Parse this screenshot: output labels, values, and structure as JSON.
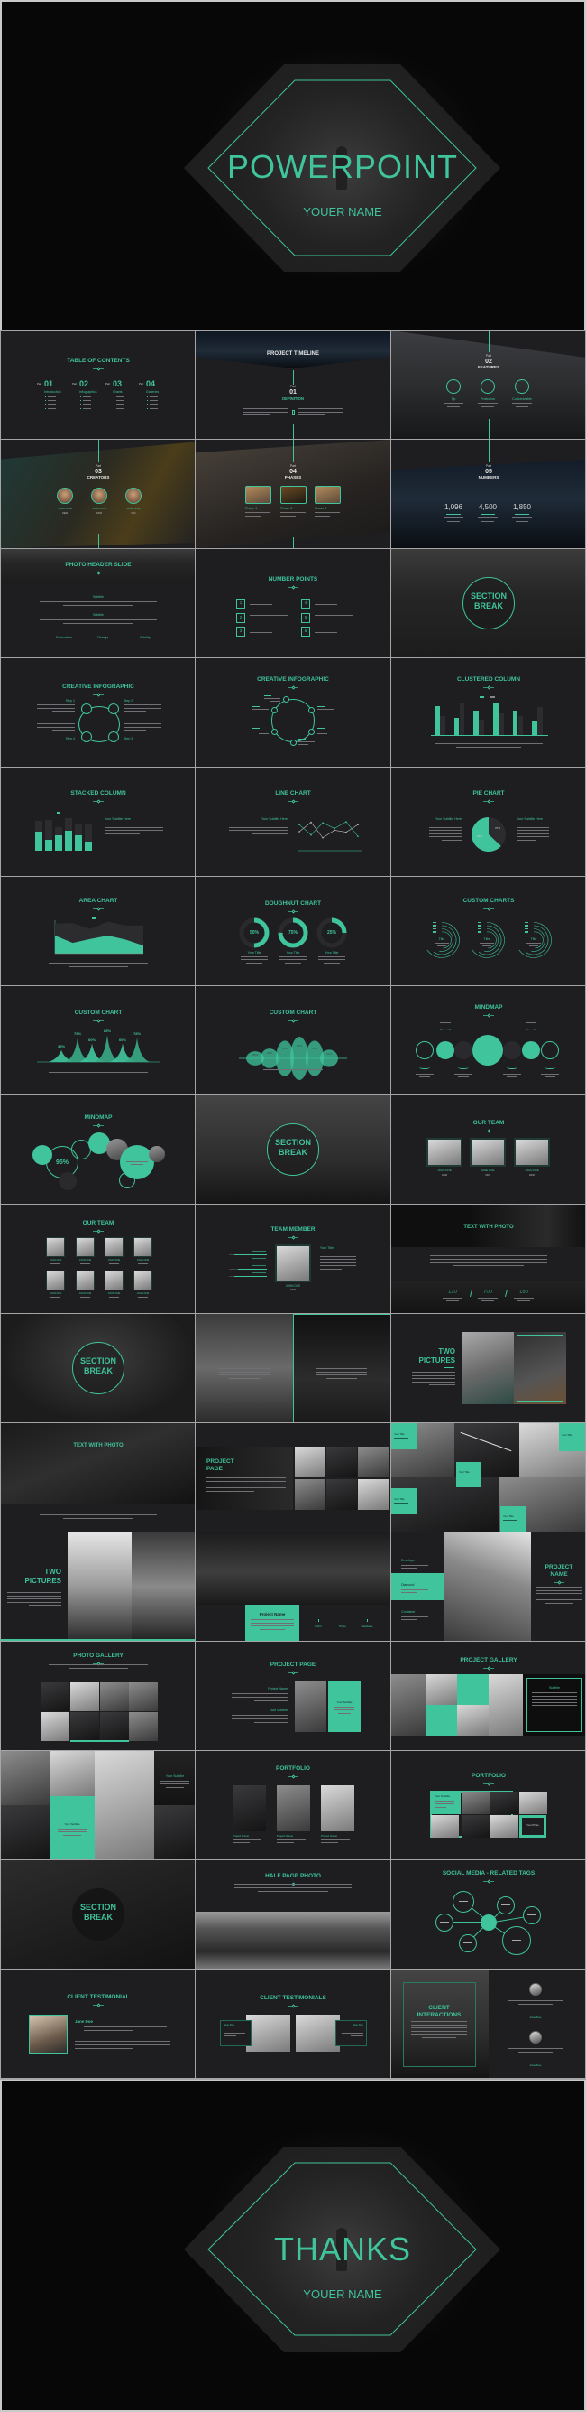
{
  "theme": {
    "accent": "#3fc49b",
    "slide_bg": "#1e1e21",
    "border": "#a5a5a5"
  },
  "cover": {
    "title": "POWERPOINT",
    "subtitle": "YOUER NAME"
  },
  "closing": {
    "title": "THANKS",
    "subtitle": "YOUER NAME"
  },
  "slides": [
    {
      "kind": "toc",
      "title": "TABLE OF CONTENTS",
      "part": "Part",
      "items": [
        {
          "num": "01",
          "label": "Introduction"
        },
        {
          "num": "02",
          "label": "Infographics"
        },
        {
          "num": "03",
          "label": "Charts"
        },
        {
          "num": "04",
          "label": "Galleries"
        }
      ]
    },
    {
      "kind": "timeline",
      "title": "PROJECT TIMELINE",
      "part": "Part",
      "num": "01",
      "heading": "DEFINITION"
    },
    {
      "kind": "features",
      "part": "Part",
      "num": "02",
      "heading": "FEATURES",
      "items": [
        "Tip",
        "Protection",
        "Customizable"
      ]
    },
    {
      "kind": "creators",
      "part": "Part",
      "num": "03",
      "heading": "CREATORS",
      "people": [
        {
          "name": "JOHN DOE",
          "role": "CEO"
        },
        {
          "name": "JOHN DOE",
          "role": "CFO"
        },
        {
          "name": "JANE DOE",
          "role": "CIO"
        }
      ]
    },
    {
      "kind": "phases",
      "part": "Part",
      "num": "04",
      "heading": "PHASES",
      "items": [
        "Phase 1",
        "Phase 2",
        "Phase 3"
      ]
    },
    {
      "kind": "numbers",
      "part": "Part",
      "num": "05",
      "heading": "NUMBERS",
      "values": [
        "1,096",
        "4,500",
        "1,850"
      ]
    },
    {
      "kind": "photoheader",
      "title": "PHOTO HEADER SLIDE",
      "subtitles": [
        "Subtitle",
        "Subtitle"
      ],
      "links": [
        "Exploration",
        "Change",
        "Fidelity"
      ]
    },
    {
      "kind": "numpoints",
      "title": "NUMBER POINTS",
      "nums": [
        "1",
        "2",
        "3",
        "4",
        "5",
        "6"
      ]
    },
    {
      "kind": "section",
      "bg": "rocks",
      "lines": [
        "SECTION",
        "BREAK"
      ]
    },
    {
      "kind": "info1",
      "title": "CREATIVE INFOGRAPHIC",
      "steps": [
        "Step 1",
        "Step 2",
        "Step 3",
        "Step 4"
      ]
    },
    {
      "kind": "info2",
      "title": "CREATIVE INFOGRAPHIC"
    },
    {
      "kind": "clustered",
      "title": "CLUSTERED COLUMN",
      "chart": {
        "type": "bar",
        "ylim": [
          0,
          11
        ],
        "series": [
          {
            "color": "#3fc49b",
            "values": [
              9.4,
              5.4,
              7.9,
              10,
              7.9,
              4.6
            ]
          },
          {
            "color": "#2c2c2f",
            "values": [
              6,
              10.5,
              5,
              7,
              6,
              9
            ]
          }
        ]
      }
    },
    {
      "kind": "stacked",
      "title": "STACKED COLUMN",
      "subtitle": "Your Subtitle Here",
      "chart": {
        "type": "stacked-bar",
        "ylim": [
          0,
          40
        ],
        "series": [
          {
            "color": "#3fc49b",
            "values": [
              21,
              12,
              17,
              22,
              17,
              10
            ]
          },
          {
            "color": "#2c2c2f",
            "values": [
              12,
              22,
              9,
              14,
              12,
              19
            ]
          }
        ]
      }
    },
    {
      "kind": "line",
      "title": "LINE CHART",
      "subtitle": "Your Subtitle Here",
      "chart": {
        "type": "line",
        "ylim": [
          0,
          5
        ],
        "series": [
          {
            "color": "#bdbdbd",
            "values": [
              2.5,
              4.5,
              1.2,
              2.8,
              2.4,
              4
            ]
          },
          {
            "color": "#3fc49b",
            "values": [
              4,
              1.8,
              4.4,
              3.2,
              4.6,
              1.5
            ]
          }
        ]
      }
    },
    {
      "kind": "pie",
      "title": "PIE CHART",
      "subtitle": "Your Subtitle Here",
      "chart": {
        "type": "pie",
        "values": [
          63,
          37
        ],
        "labels": [
          "63%",
          "37%"
        ],
        "colors": [
          "#3fc49b",
          "#2c2c2f"
        ]
      }
    },
    {
      "kind": "area",
      "title": "AREA CHART",
      "chart": {
        "type": "area",
        "ylim": [
          0,
          5
        ],
        "series": [
          {
            "color": "#2c2c2f",
            "values": [
              4.5,
              4.6,
              3.7,
              4.8,
              4.2,
              4.2
            ]
          },
          {
            "color": "#3fc49b",
            "values": [
              2.7,
              1.6,
              2.2,
              2.7,
              2.1,
              1.2
            ]
          }
        ]
      }
    },
    {
      "kind": "doughnut",
      "title": "DOUGHNUT CHART",
      "caption": "Your Title",
      "values": [
        50,
        75,
        25
      ],
      "labels": [
        "50%",
        "75%",
        "25%"
      ]
    },
    {
      "kind": "arcs",
      "title": "CUSTOM CHARTS",
      "caption": "Title"
    },
    {
      "kind": "peaks",
      "title": "CUSTOM CHART",
      "values": [
        39,
        79,
        60,
        88,
        60,
        78
      ],
      "labels": [
        "39%",
        "79%",
        "60%",
        "88%",
        "60%",
        "78%"
      ]
    },
    {
      "kind": "bumps",
      "title": "CUSTOM CHART",
      "values": [
        18,
        25,
        45,
        55,
        45,
        22
      ],
      "labels": [
        "18%",
        "25%",
        "45%",
        "55%",
        "45%",
        "22%"
      ]
    },
    {
      "kind": "mindmap1",
      "title": "MINDMAP"
    },
    {
      "kind": "mindmap2",
      "title": "MINDMAP",
      "value": "95%"
    },
    {
      "kind": "section",
      "bg": "clouds",
      "lines": [
        "SECTION",
        "BREAK"
      ]
    },
    {
      "kind": "team3",
      "title": "OUR TEAM",
      "people": [
        {
          "name": "JOHN DOE",
          "role": "CEO"
        },
        {
          "name": "JANE DOE",
          "role": "CIO"
        },
        {
          "name": "JOHN DOE",
          "role": "CFO"
        }
      ]
    },
    {
      "kind": "team8",
      "title": "OUR TEAM",
      "people": [
        "JOHN DOE",
        "JOHN DOE",
        "JOHN DOE",
        "JOHN DOE",
        "JOHN DOE",
        "JOHN DOE",
        "JOHN DOE",
        "JOHN DOE"
      ]
    },
    {
      "kind": "member",
      "title": "TEAM MEMBER",
      "name": "JOHN DOE",
      "role": "CEO",
      "subtitle": "Your Title"
    },
    {
      "kind": "textphoto1",
      "title": "TEXT WITH PHOTO",
      "stats": [
        "120",
        "700",
        "180"
      ]
    },
    {
      "kind": "section",
      "bg": "tortoise",
      "lines": [
        "SECTION",
        "BREAK"
      ]
    },
    {
      "kind": "twopanels"
    },
    {
      "kind": "twopics1",
      "lines": [
        "TWO",
        "PICTURES"
      ]
    },
    {
      "kind": "textphoto2",
      "title": "TEXT WITH PHOTO"
    },
    {
      "kind": "projectpage1",
      "lines": [
        "PROJECT",
        "PAGE"
      ]
    },
    {
      "kind": "collage1",
      "boxes": [
        "Your Title",
        "Your Title",
        "Your Title",
        "Your Title",
        "Your Title"
      ]
    },
    {
      "kind": "twopics2",
      "lines": [
        "TWO",
        "PICTURES"
      ]
    },
    {
      "kind": "projectname1",
      "name": "Project Name",
      "items": [
        "Infinit",
        "Photo",
        "Database"
      ]
    },
    {
      "kind": "projectname2",
      "lines": [
        "PROJECT",
        "NAME"
      ],
      "items": [
        "Envelope",
        "Diamond",
        "Container"
      ]
    },
    {
      "kind": "gallery",
      "title": "PHOTO GALLERY"
    },
    {
      "kind": "projectpage2",
      "title": "PROJECT PAGE",
      "labels": [
        "Project Name",
        "Your Subtitle"
      ],
      "box": "Your Subtitle"
    },
    {
      "kind": "pgallery",
      "title": "PROJECT GALLERY",
      "box": "Subtitle"
    },
    {
      "kind": "collage2",
      "labels": [
        "Your Subtitle",
        "Your Subtitle"
      ]
    },
    {
      "kind": "portfolio1",
      "title": "PORTFOLIO",
      "items": [
        "Project Name",
        "Project Name",
        "Project Name"
      ]
    },
    {
      "kind": "portfolio2",
      "title": "PORTFOLIO",
      "label": "Your Subtitle",
      "photo": "Your Photo"
    },
    {
      "kind": "section",
      "bg": "forest",
      "lines": [
        "SECTION",
        "BREAK"
      ]
    },
    {
      "kind": "halfphoto",
      "title": "HALF PAGE PHOTO"
    },
    {
      "kind": "social",
      "title": "SOCIAL MEDIA - RELATED TAGS"
    },
    {
      "kind": "testimonial",
      "title": "CLIENT TESTIMONIAL",
      "name": "Jane Doe"
    },
    {
      "kind": "testimonials",
      "title": "CLIENT TESTIMONIALS",
      "names": [
        "Jane Doe",
        "Jane Doe"
      ]
    },
    {
      "kind": "interactions",
      "lines": [
        "CLIENT",
        "INTERACTIONS"
      ],
      "names": [
        "Jane Doe",
        "Jane Doe"
      ]
    }
  ]
}
